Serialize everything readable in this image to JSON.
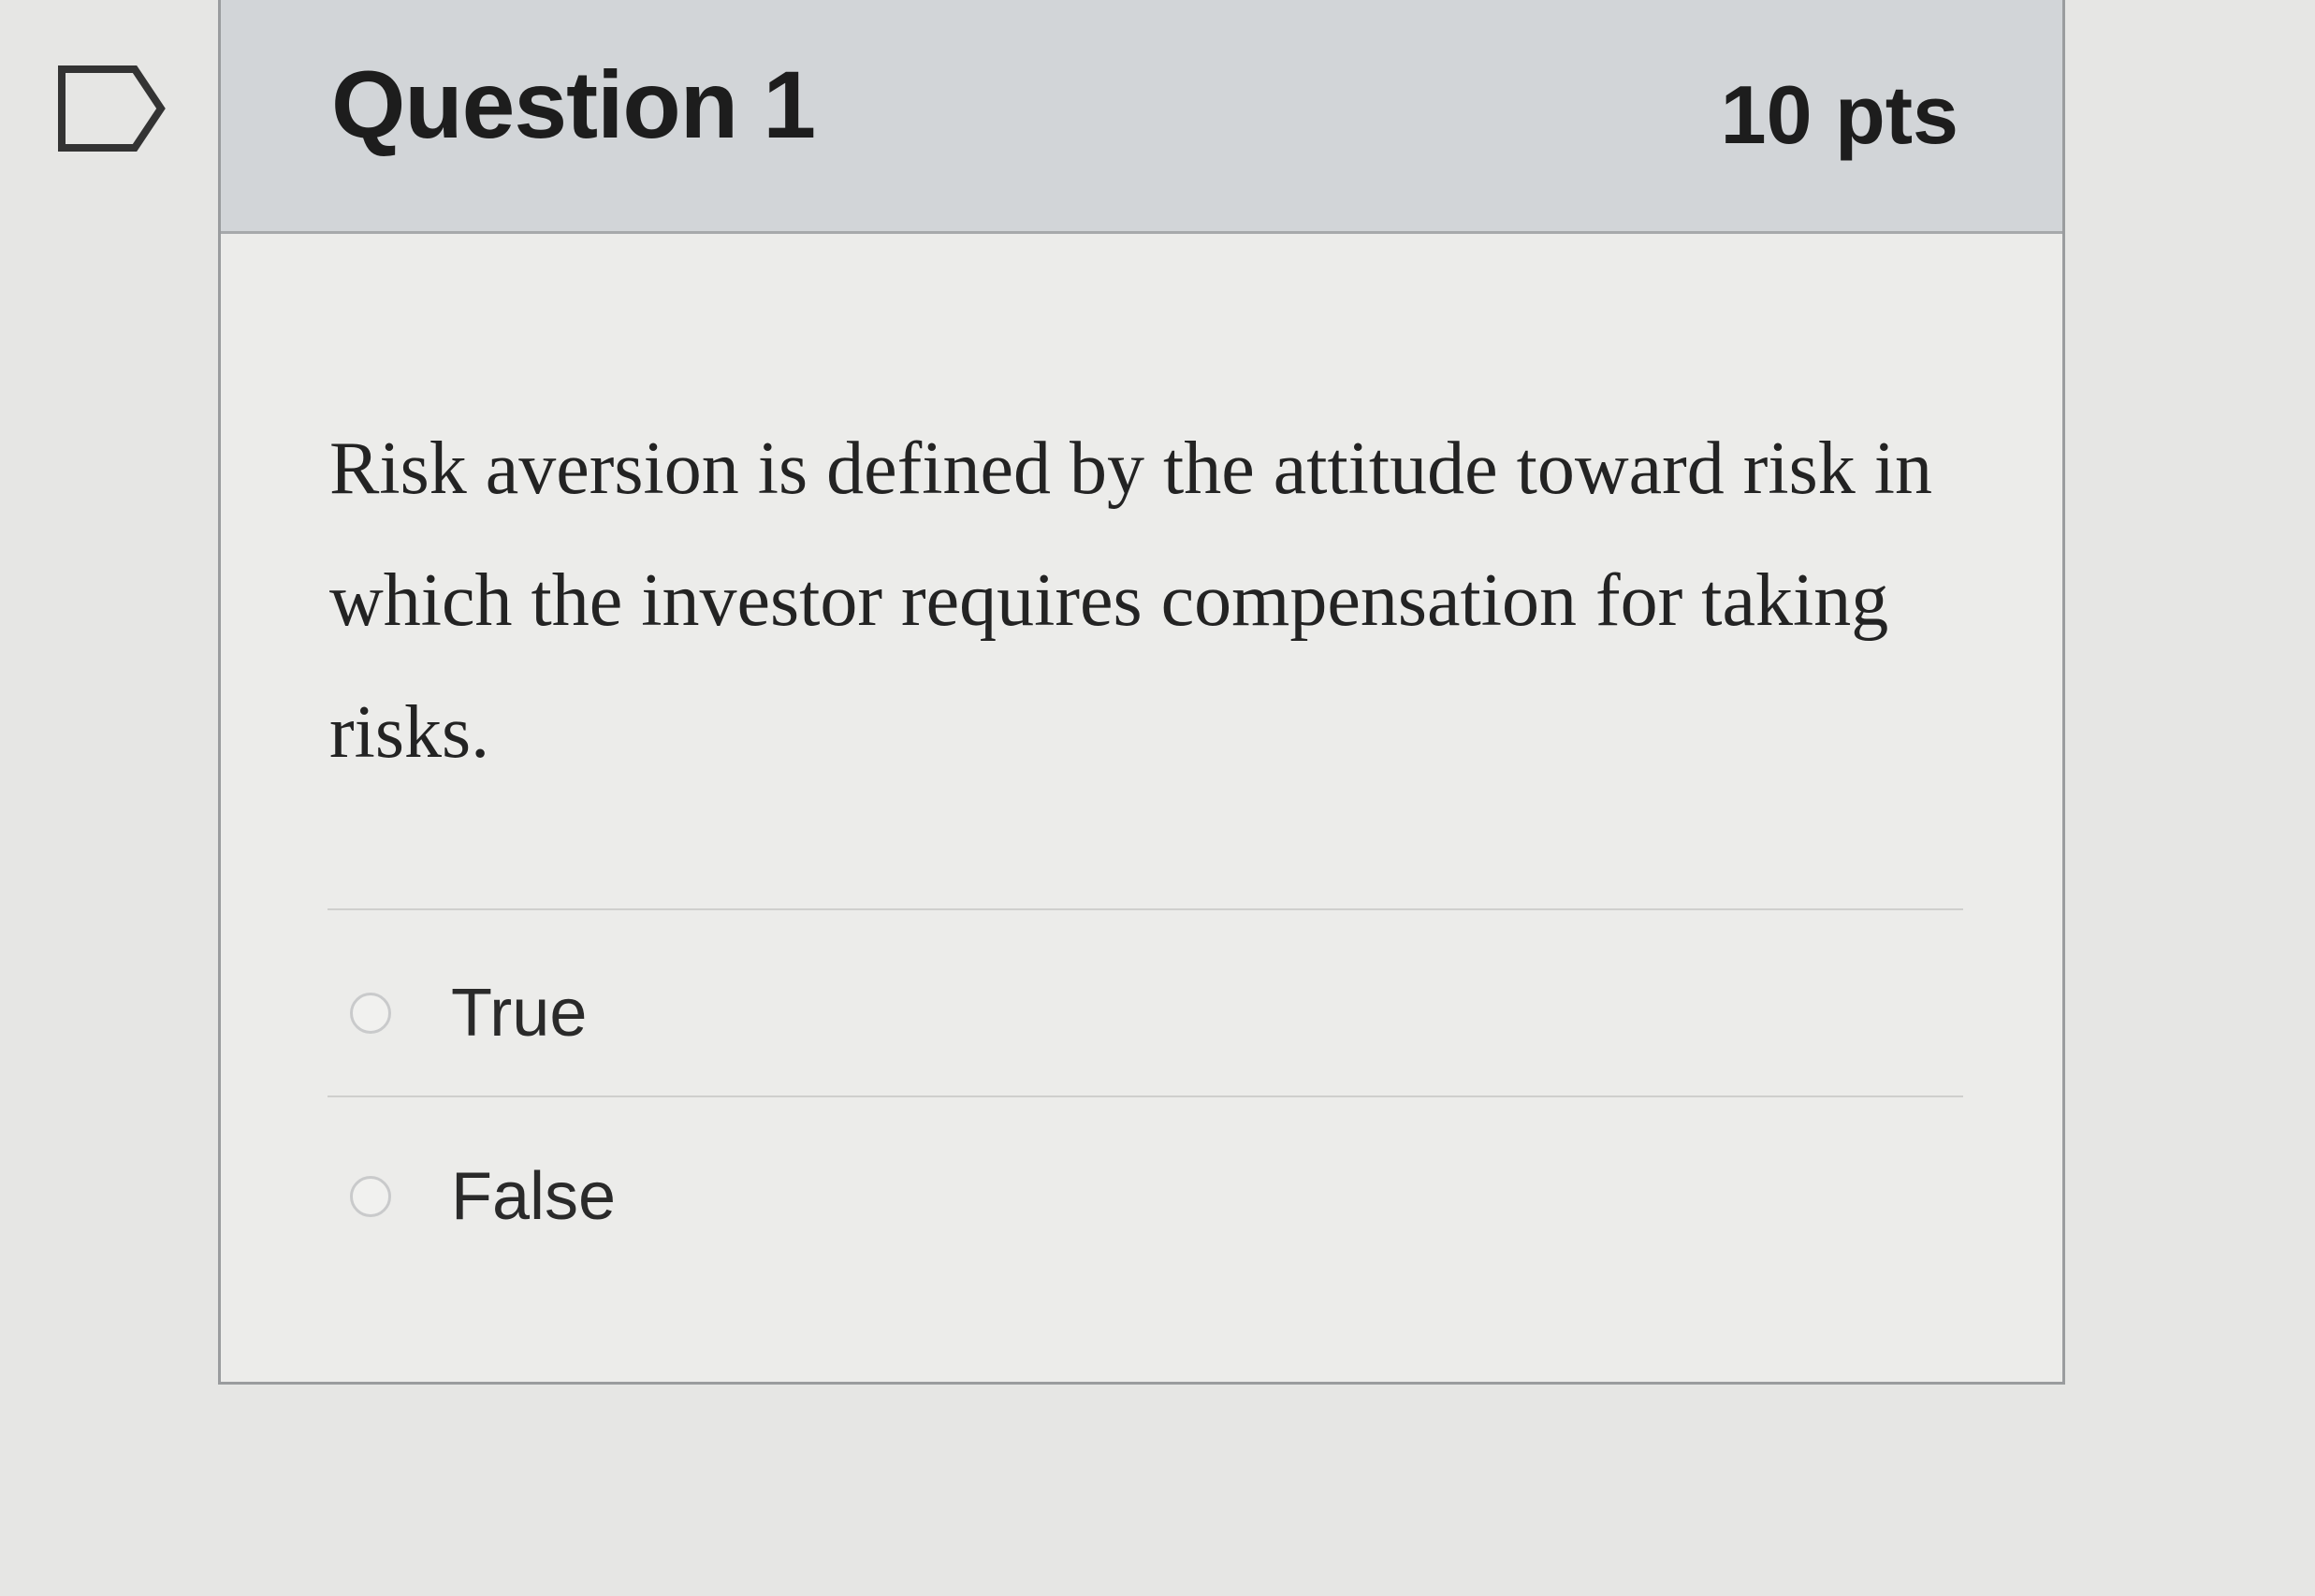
{
  "icons": {
    "flag": "flag-outline-icon"
  },
  "colors": {
    "header_background": "#d2d5d8",
    "card_background": "#ececea",
    "page_background": "#e6e6e4",
    "text": "#1d1d1d",
    "border": "#9a9c9e"
  },
  "question": {
    "title": "Question 1",
    "points": "10 pts",
    "text": "Risk aversion is defined by the attitude toward risk in which the investor requires compensation for taking risks.",
    "answers": [
      {
        "label": "True",
        "selected": false
      },
      {
        "label": "False",
        "selected": false
      }
    ]
  }
}
